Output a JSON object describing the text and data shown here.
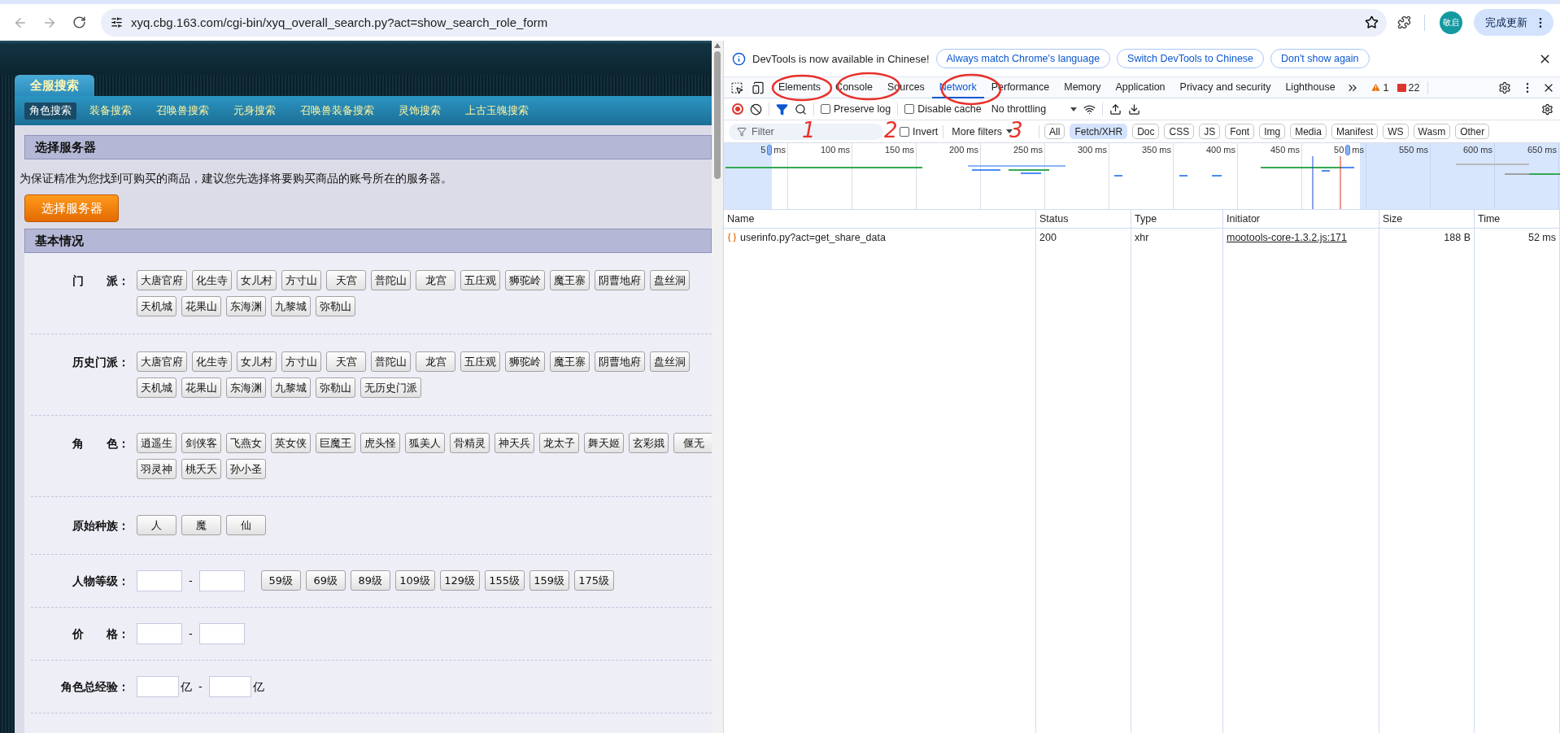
{
  "browser": {
    "url": "xyq.cbg.163.com/cgi-bin/xyq_overall_search.py?act=show_search_role_form",
    "avatar": "敬启",
    "update_button": "完成更新"
  },
  "page": {
    "main_tab": "全服搜索",
    "sub_tabs": [
      {
        "label": "角色搜索",
        "selected": true
      },
      {
        "label": "装备搜索",
        "selected": false
      },
      {
        "label": "召唤兽搜索",
        "selected": false
      },
      {
        "label": "元身搜索",
        "selected": false
      },
      {
        "label": "召唤兽装备搜索",
        "selected": false
      },
      {
        "label": "灵饰搜索",
        "selected": false
      },
      {
        "label": "上古玉魄搜索",
        "selected": false
      }
    ],
    "server_section": {
      "title": "选择服务器",
      "notice": "为保证精准为您找到可购买的商品，建议您先选择将要购买商品的账号所在的服务器。",
      "button": "选择服务器"
    },
    "basic_section": {
      "title": "基本情况",
      "rows": [
        {
          "kind": "options",
          "label": "门　　派：",
          "lines": [
            [
              "大唐官府",
              "化生寺",
              "女儿村",
              "方寸山",
              "天宫",
              "普陀山",
              "龙宫",
              "五庄观",
              "狮驼岭",
              "魔王寨",
              "阴曹地府",
              "盘丝洞"
            ],
            [
              "天机城",
              "花果山",
              "东海渊",
              "九黎城",
              "弥勒山"
            ]
          ]
        },
        {
          "kind": "options",
          "label": "历史门派：",
          "lines": [
            [
              "大唐官府",
              "化生寺",
              "女儿村",
              "方寸山",
              "天宫",
              "普陀山",
              "龙宫",
              "五庄观",
              "狮驼岭",
              "魔王寨",
              "阴曹地府",
              "盘丝洞"
            ],
            [
              "天机城",
              "花果山",
              "东海渊",
              "九黎城",
              "弥勒山",
              "无历史门派"
            ]
          ]
        },
        {
          "kind": "options",
          "label": "角　　色：",
          "lines": [
            [
              "逍遥生",
              "剑侠客",
              "飞燕女",
              "英女侠",
              "巨魔王",
              "虎头怪",
              "狐美人",
              "骨精灵",
              "神天兵",
              "龙太子",
              "舞天姬",
              "玄彩娥",
              "偃无"
            ],
            [
              "羽灵神",
              "桃夭夭",
              "孙小圣"
            ]
          ]
        },
        {
          "kind": "options",
          "label": "原始种族：",
          "lines": [
            [
              "人",
              "魔",
              "仙"
            ]
          ]
        },
        {
          "kind": "range",
          "label": "人物等级：",
          "separator": "-",
          "quick": [
            "59级",
            "69级",
            "89级",
            "109级",
            "129级",
            "155级",
            "159级",
            "175级"
          ]
        },
        {
          "kind": "range",
          "label": "价　　格：",
          "separator": "-"
        },
        {
          "kind": "range",
          "label": "角色总经验：",
          "separator": "-",
          "units": [
            "亿",
            "亿"
          ]
        }
      ]
    }
  },
  "devtools": {
    "infobar": {
      "message": "DevTools is now available in Chinese!",
      "buttons": [
        "Always match Chrome's language",
        "Switch DevTools to Chinese",
        "Don't show again"
      ]
    },
    "panel_tabs": [
      {
        "label": "Elements",
        "selected": false
      },
      {
        "label": "Console",
        "selected": false
      },
      {
        "label": "Sources",
        "selected": false
      },
      {
        "label": "Network",
        "selected": true
      },
      {
        "label": "Performance",
        "selected": false
      },
      {
        "label": "Memory",
        "selected": false
      },
      {
        "label": "Application",
        "selected": false
      },
      {
        "label": "Privacy and security",
        "selected": false
      },
      {
        "label": "Lighthouse",
        "selected": false
      }
    ],
    "warnings": "1",
    "errors": "22",
    "toolbar": {
      "preserve_log": {
        "label": "Preserve log",
        "checked": false
      },
      "disable_cache": {
        "label": "Disable cache",
        "checked": false
      },
      "throttling": "No throttling"
    },
    "filter": {
      "placeholder": "Filter",
      "invert": {
        "label": "Invert",
        "checked": false
      },
      "more_filters": "More filters",
      "types": [
        {
          "label": "All",
          "selected": false
        },
        {
          "label": "Fetch/XHR",
          "selected": true
        },
        {
          "label": "Doc",
          "selected": false
        },
        {
          "label": "CSS",
          "selected": false
        },
        {
          "label": "JS",
          "selected": false
        },
        {
          "label": "Font",
          "selected": false
        },
        {
          "label": "Img",
          "selected": false
        },
        {
          "label": "Media",
          "selected": false
        },
        {
          "label": "Manifest",
          "selected": false
        },
        {
          "label": "WS",
          "selected": false
        },
        {
          "label": "Wasm",
          "selected": false
        },
        {
          "label": "Other",
          "selected": false
        }
      ]
    },
    "timeline": {
      "ticks": [
        {
          "pre": "5",
          "label": "ms"
        },
        {
          "label": "100 ms"
        },
        {
          "label": "150 ms"
        },
        {
          "label": "200 ms"
        },
        {
          "label": "250 ms"
        },
        {
          "label": "300 ms"
        },
        {
          "label": "350 ms"
        },
        {
          "label": "400 ms"
        },
        {
          "label": "450 ms"
        },
        {
          "pre": "50",
          "label": "ms"
        },
        {
          "label": "550 ms"
        },
        {
          "label": "600 ms"
        },
        {
          "label": "650 ms"
        }
      ]
    },
    "table": {
      "columns": [
        "Name",
        "Status",
        "Type",
        "Initiator",
        "Size",
        "Time"
      ],
      "rows": [
        {
          "name": "userinfo.py?act=get_share_data",
          "status": "200",
          "type": "xhr",
          "initiator": "mootools-core-1.3.2.js:171",
          "size": "188 B",
          "time": "52 ms"
        }
      ]
    },
    "annotations": [
      "1",
      "2",
      "3"
    ]
  }
}
